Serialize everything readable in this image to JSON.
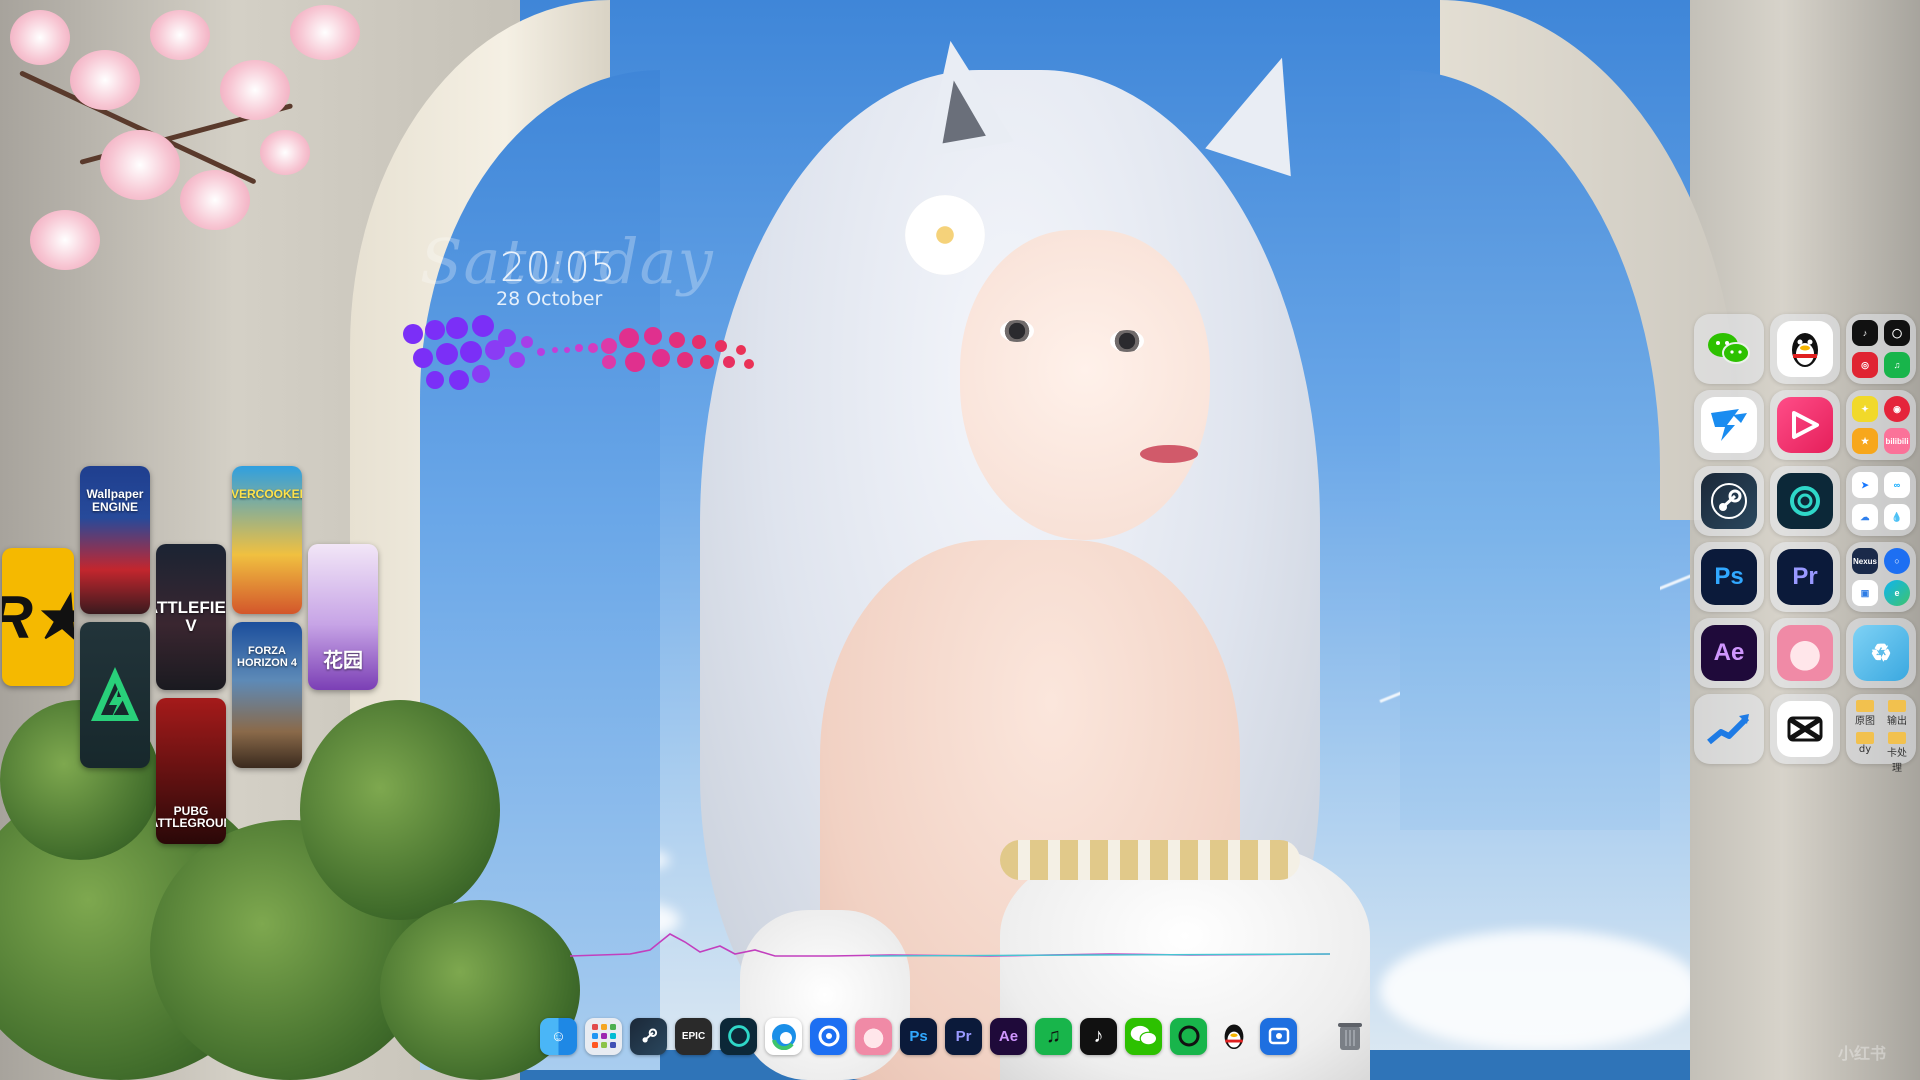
{
  "colors": {
    "accent_purple": "#7b2ff7",
    "accent_magenta": "#e0308e",
    "ps_blue": "#31a8ff",
    "pr_purple": "#9999ff",
    "ae_purple": "#cf96fd",
    "adobe_bg": "#0b1a3a"
  },
  "clock": {
    "time": "20:05",
    "day_script": "Saturday",
    "date": "28 October"
  },
  "games": [
    {
      "name": "rockstar-games",
      "label": "R★",
      "icon": "rockstar-logo-icon"
    },
    {
      "name": "wallpaper-engine",
      "label": "Wallpaper ENGINE",
      "icon": "wallpaper-engine-icon"
    },
    {
      "name": "arena-breakout",
      "label": "",
      "icon": "green-chevron-logo-icon"
    },
    {
      "name": "battlefield-v",
      "label": "BATTLEFIELD V",
      "icon": "battlefield-icon"
    },
    {
      "name": "pubg",
      "label": "PUBG BATTLEGROUND",
      "icon": "pubg-icon"
    },
    {
      "name": "overcooked",
      "label": "OVERCOOKED!",
      "icon": "overcooked-icon"
    },
    {
      "name": "forza-horizon-4",
      "label": "FORZA HORIZON 4",
      "icon": "forza-icon"
    },
    {
      "name": "anime-game",
      "label": "花园",
      "icon": "anime-game-icon"
    }
  ],
  "right_apps": {
    "large": [
      {
        "name": "wechat",
        "icon": "wechat-icon"
      },
      {
        "name": "qq",
        "icon": "qq-penguin-icon"
      },
      {
        "name": "thunder",
        "icon": "thunder-icon"
      },
      {
        "name": "kuaishou",
        "icon": "video-play-icon"
      },
      {
        "name": "steam",
        "icon": "steam-icon"
      },
      {
        "name": "power",
        "icon": "power-ring-icon"
      },
      {
        "name": "photoshop",
        "label": "Ps"
      },
      {
        "name": "premiere",
        "label": "Pr"
      },
      {
        "name": "after-effects",
        "label": "Ae"
      },
      {
        "name": "anime-avatar",
        "icon": "anime-avatar-icon"
      },
      {
        "name": "stocks",
        "icon": "chart-up-icon"
      },
      {
        "name": "capcut",
        "icon": "capcut-icon"
      },
      {
        "name": "recycle",
        "icon": "recycle-icon"
      }
    ],
    "folders": [
      {
        "name": "folder-social",
        "items": [
          "tiktok-icon",
          "chat-icon",
          "red-icon",
          "music-icon"
        ]
      },
      {
        "name": "folder-media",
        "items": [
          "bird-icon",
          "netease-icon",
          "game-icon",
          "bilibili-icon"
        ]
      },
      {
        "name": "folder-tools",
        "items": [
          "feishu-icon",
          "cloud-icon",
          "baidu-icon",
          "drop-icon"
        ]
      },
      {
        "name": "folder-web",
        "items": [
          "nexus-icon",
          "browser-icon",
          "screen-icon",
          "edge-icon"
        ]
      },
      {
        "name": "folder-files",
        "labels": [
          "原图",
          "输出",
          "dy",
          "卡处理"
        ]
      }
    ],
    "nexus_label": "Nexus",
    "bilibili_label": "bilibili"
  },
  "dock": [
    {
      "name": "finder",
      "icon": "finder-icon"
    },
    {
      "name": "launchpad",
      "icon": "grid-icon"
    },
    {
      "name": "steam",
      "icon": "steam-icon"
    },
    {
      "name": "epic-games",
      "label": "EPIC",
      "icon": "epic-icon"
    },
    {
      "name": "power",
      "icon": "power-ring-icon"
    },
    {
      "name": "edge",
      "icon": "edge-icon"
    },
    {
      "name": "browser",
      "icon": "circle-browser-icon"
    },
    {
      "name": "anime-avatar",
      "icon": "anime-avatar-icon"
    },
    {
      "name": "photoshop",
      "label": "Ps"
    },
    {
      "name": "premiere",
      "label": "Pr"
    },
    {
      "name": "after-effects",
      "label": "Ae"
    },
    {
      "name": "music",
      "icon": "music-icon"
    },
    {
      "name": "tiktok",
      "icon": "tiktok-icon"
    },
    {
      "name": "wechat",
      "icon": "wechat-icon"
    },
    {
      "name": "chat",
      "icon": "chat-bubble-icon"
    },
    {
      "name": "qq",
      "icon": "qq-penguin-icon"
    },
    {
      "name": "screenshot",
      "icon": "camera-icon"
    },
    {
      "name": "trash",
      "icon": "trash-icon"
    }
  ],
  "watermark": "小红书"
}
